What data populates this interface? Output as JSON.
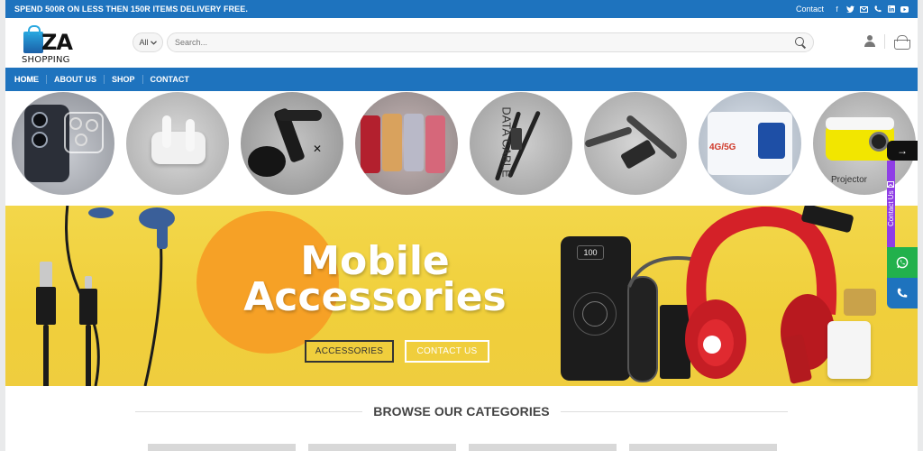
{
  "topbar": {
    "promo": "SPEND 500R ON LESS THEN 150R ITEMS DELIVERY FREE.",
    "contact": "Contact",
    "socials": [
      "facebook-icon",
      "twitter-icon",
      "email-icon",
      "phone-icon",
      "linkedin-icon",
      "youtube-icon"
    ]
  },
  "logo": {
    "mark": "ZA",
    "tagline": "SHOPPING"
  },
  "search": {
    "category": "All",
    "placeholder": "Search..."
  },
  "nav": [
    "HOME",
    "ABOUT US",
    "SHOP",
    "CONTACT"
  ],
  "categories": [
    "camera-protector",
    "earbuds",
    "car-phone-holder",
    "phone-cases",
    "data-cable",
    "audio-adapter",
    "router",
    "projector"
  ],
  "category_texts": {
    "cable": "DATA CABLE",
    "router": "4G/5G",
    "projector": "Projector"
  },
  "banner": {
    "headline_1": "Mobile",
    "headline_2": "Accessories",
    "button_1": "ACCESSORIES",
    "button_2": "CONTACT US",
    "powerbank_display": "100"
  },
  "floating": {
    "contact": "Contact Us",
    "arrow": "→"
  },
  "browse": {
    "heading": "BROWSE OUR CATEGORIES"
  }
}
